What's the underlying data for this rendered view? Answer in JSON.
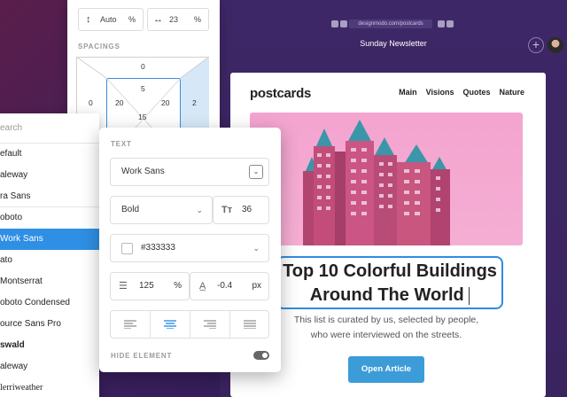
{
  "browser": {
    "url": "designmodo.com/postcards",
    "page_title": "Sunday Newsletter",
    "add_icon": "plus-icon"
  },
  "email": {
    "brand": "postcards",
    "nav": [
      "Main",
      "Visions",
      "Quotes",
      "Nature"
    ],
    "headline_line1": "Top 10 Colorful Buildings",
    "headline_line2": "Around The World",
    "subtitle_line1": "This list is curated by us, selected by people,",
    "subtitle_line2": "who were interviewed on the streets.",
    "button": "Open Article"
  },
  "spacing_panel": {
    "height_value": "Auto",
    "height_unit": "%",
    "width_value": "23",
    "width_unit": "%",
    "label": "SPACINGS",
    "margin_top": "0",
    "margin_left": "0",
    "margin_right": "2",
    "padding_top": "5",
    "padding_left": "20",
    "padding_right": "20",
    "padding_bottom": "15"
  },
  "font_list": {
    "search_placeholder": "earch",
    "items": [
      "efault",
      "aleway",
      "ra Sans",
      "oboto",
      "Work Sans",
      "ato",
      "Montserrat",
      "oboto Condensed",
      "ource Sans Pro",
      "swald",
      "aleway",
      "lerriweather"
    ],
    "selected_index": 4
  },
  "text_panel": {
    "label": "TEXT",
    "font_family": "Work Sans",
    "font_weight": "Bold",
    "font_size": "36",
    "color": "#333333",
    "line_height": "125",
    "line_height_unit": "%",
    "letter_spacing": "-0.4",
    "letter_spacing_unit": "px",
    "hide_label": "HIDE ELEMENT",
    "active_align": "center",
    "colors": {
      "accent": "#2f8fe4",
      "swatch": "#ffffff"
    }
  }
}
